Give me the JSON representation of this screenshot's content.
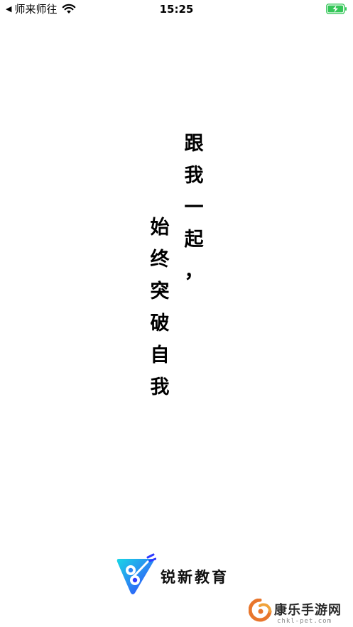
{
  "status_bar": {
    "back_app": "师来师往",
    "time": "15:25"
  },
  "slogan": {
    "right_column": [
      "跟",
      "我",
      "一",
      "起",
      "，"
    ],
    "left_column": [
      "始",
      "终",
      "突",
      "破",
      "自",
      "我"
    ]
  },
  "brand": {
    "name": "锐新教育"
  },
  "watermark": {
    "title": "康乐手游网",
    "url": "chkl-pet.com"
  },
  "colors": {
    "background": "#ffffff",
    "text": "#000000",
    "brand_blue": "#2f5bff",
    "brand_cyan": "#19d6e6",
    "battery_green": "#35c759",
    "watermark_orange": "#e8762c"
  }
}
